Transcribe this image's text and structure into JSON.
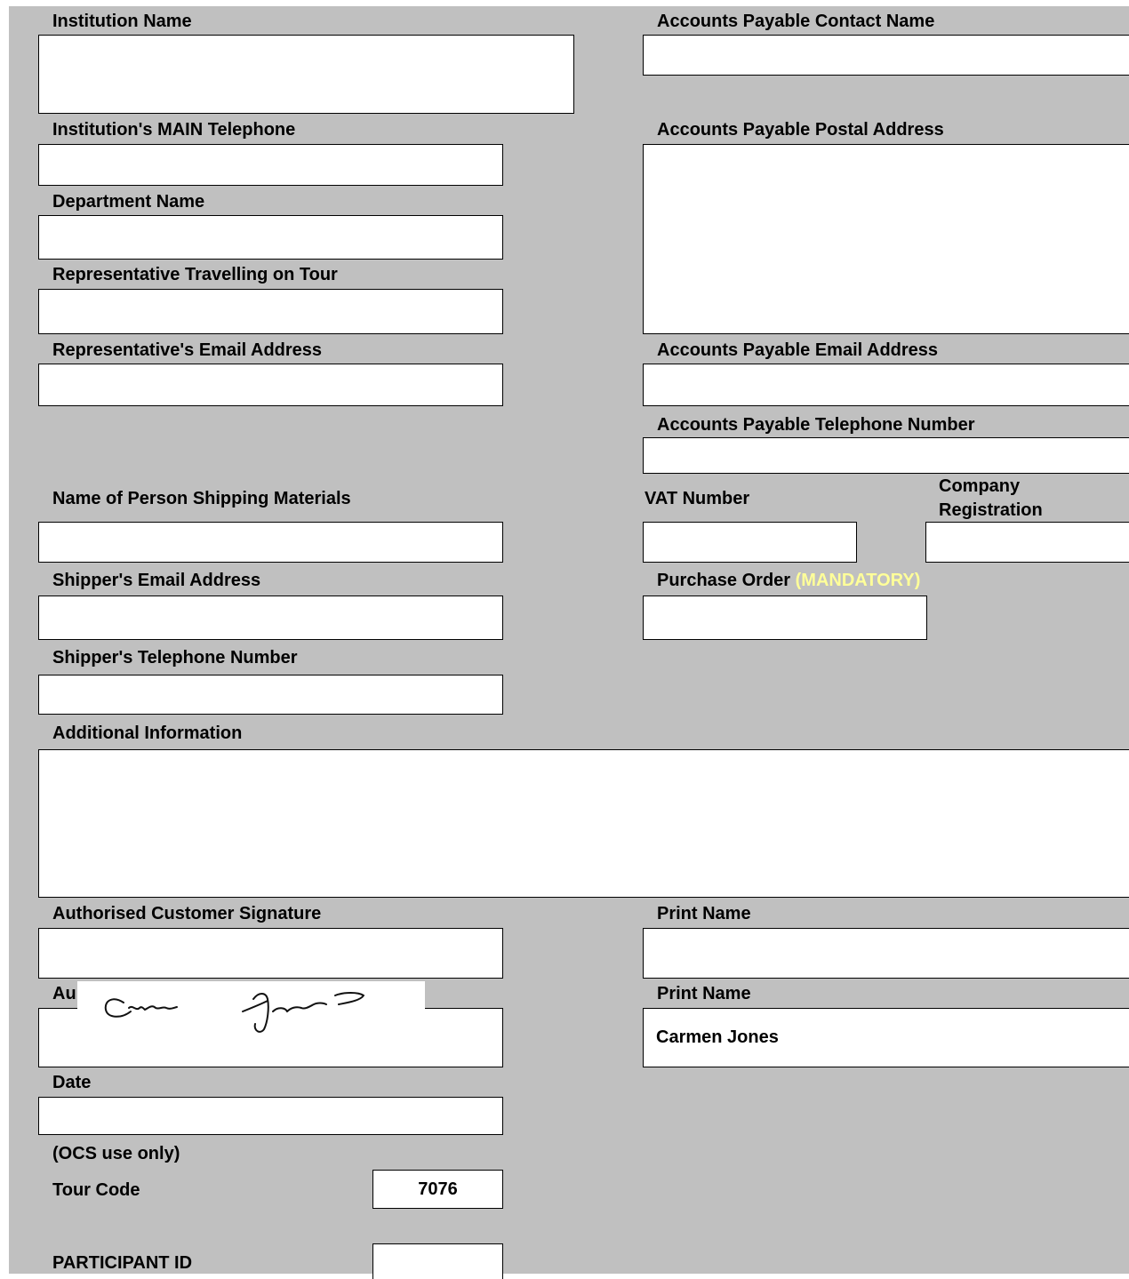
{
  "labels": {
    "institution_name": "Institution Name",
    "main_telephone": "Institution's MAIN Telephone",
    "department_name": "Department Name",
    "representative": "Representative Travelling on Tour",
    "rep_email": "Representative's Email Address",
    "ap_contact": "Accounts Payable Contact Name",
    "ap_postal": "Accounts Payable Postal Address",
    "ap_email": "Accounts Payable Email Address",
    "ap_phone": "Accounts Payable Telephone Number",
    "shipper_name": "Name of Person Shipping Materials",
    "vat": "VAT Number",
    "company_reg_1": "Company",
    "company_reg_2": "Registration",
    "shipper_email": "Shipper's Email Address",
    "purchase_order": "Purchase Order",
    "mandatory": "(MANDATORY)",
    "shipper_phone": "Shipper's Telephone Number",
    "additional_info": "Additional Information",
    "auth_signature": "Authorised Customer Signature",
    "print_name_1": "Print Name",
    "auth_partial": "Au",
    "print_name_2": "Print Name",
    "date": "Date",
    "ocs_only": "(OCS use only)",
    "tour_code": "Tour Code",
    "participant_id": "PARTICIPANT ID"
  },
  "values": {
    "print_name_2": "Carmen Jones",
    "tour_code": "7076"
  },
  "signature": {
    "text": "Carmen Jones",
    "ink_color": "#111111"
  },
  "colors": {
    "form_background": "#c0c0c0",
    "field_background": "#ffffff",
    "mandatory_text": "#ffff99"
  }
}
